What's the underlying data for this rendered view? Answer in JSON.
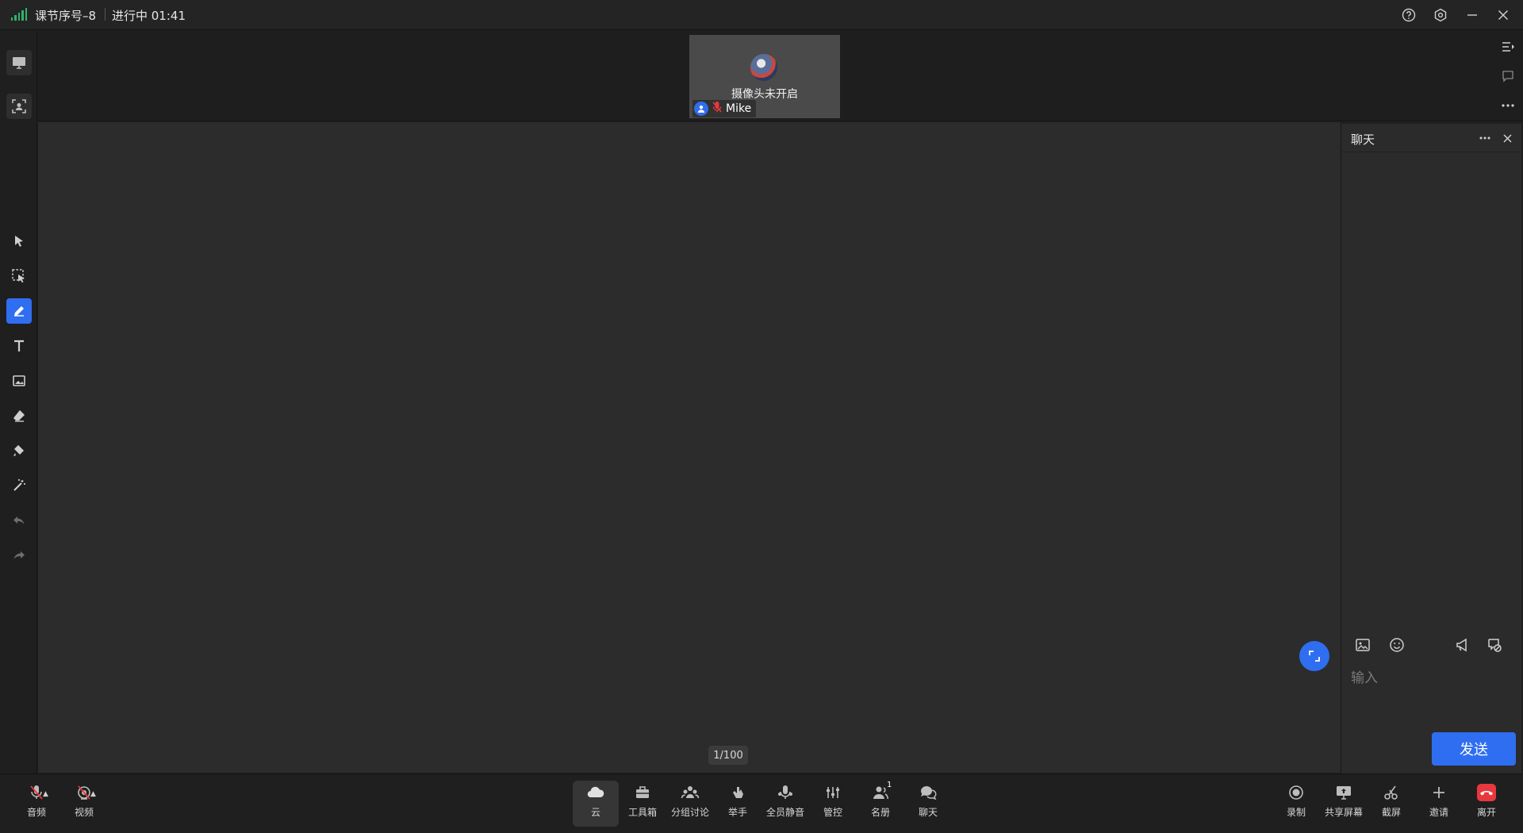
{
  "titlebar": {
    "course": "课节序号–8",
    "status": "进行中 01:41"
  },
  "video": {
    "camera_off": "摄像头未开启",
    "participant": "Mike"
  },
  "board": {
    "page_indicator": "1/100"
  },
  "chat": {
    "title": "聊天",
    "input_placeholder": "输入",
    "send_label": "发送"
  },
  "bottom": {
    "audio": "音频",
    "video": "视频",
    "cloud": "云",
    "toolbox": "工具箱",
    "breakout": "分组讨论",
    "raise_hand": "举手",
    "mute_all": "全员静音",
    "control": "管控",
    "roster": "名册",
    "roster_count": "1",
    "chat": "聊天",
    "record": "录制",
    "share_screen": "共享屏幕",
    "screenshot": "截屏",
    "invite": "邀请",
    "leave": "离开"
  },
  "colors": {
    "accent": "#2f6ef0",
    "signal": "#2fb36e",
    "leave": "#e8383d"
  }
}
